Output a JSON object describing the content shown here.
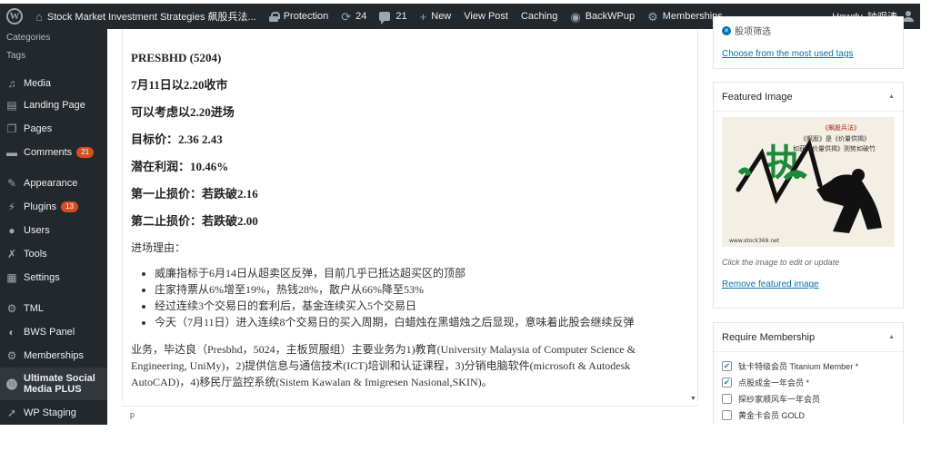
{
  "adminbar": {
    "site_title": "Stock Market Investment Strategies 飙股兵法...",
    "protection": "Protection",
    "updates_count": "24",
    "comments_count": "21",
    "new_label": "New",
    "view_post": "View Post",
    "caching": "Caching",
    "backwpup": "BackWPup",
    "memberships": "Memberships",
    "howdy": "Howdy, 钟观涛"
  },
  "sidebar": {
    "sub_items": [
      "Categories",
      "Tags"
    ],
    "items": [
      {
        "label": "Media",
        "icon": "media-icon"
      },
      {
        "label": "Landing Page",
        "icon": "landing-page-icon"
      },
      {
        "label": "Pages",
        "icon": "pages-icon"
      },
      {
        "label": "Comments",
        "icon": "comments-icon",
        "badge": "21"
      },
      {
        "label": "Appearance",
        "icon": "appearance-icon"
      },
      {
        "label": "Plugins",
        "icon": "plugins-icon",
        "badge": "13"
      },
      {
        "label": "Users",
        "icon": "users-icon"
      },
      {
        "label": "Tools",
        "icon": "tools-icon"
      },
      {
        "label": "Settings",
        "icon": "settings-icon"
      },
      {
        "label": "TML",
        "icon": "tml-icon"
      },
      {
        "label": "BWS Panel",
        "icon": "bws-icon"
      },
      {
        "label": "Memberships",
        "icon": "memberships-icon"
      },
      {
        "label": "Ultimate Social Media PLUS",
        "icon": "usm-icon"
      },
      {
        "label": "WP Staging",
        "icon": "staging-icon"
      }
    ]
  },
  "content": {
    "line1": "PRESBHD (5204)",
    "line2": "7月11日以2.20收市",
    "line3": "可以考虑以2.20进场",
    "line4": "目标价：2.36  2.43",
    "line5": "潜在利润：10.46%",
    "line6": "第一止损价：若跌破2.16",
    "line7": "第二止损价：若跌破2.00",
    "reason_heading": "进场理由：",
    "reasons": [
      "威廉指标于6月14日从超卖区反弹，目前几乎已抵达超买区的顶部",
      "庄家持票从6%增至19%，热钱28%，散户从66%降至53%",
      "经过连续3个交易日的套利后，基金连续买入5个交易日",
      "今天（7月11日）进入连续8个交易日的买入周期，白蜡烛在黑蜡烛之后显现，意味着此股会继续反弹"
    ],
    "business": "业务，毕达良（Presbhd，5024，主板贸服组）主要业务为1)教育(University Malaysia of Computer Science & Engineering, UniMy)，2)提供信息与通信技术(ICT)培训和认证课程，3)分销电脑软件(microsoft & Autodesk AutoCAD)，4)移民厅监控系统(Sistem Kawalan & Imigresen Nasional,SKIN)。"
  },
  "statusbar": {
    "path": "p"
  },
  "tags_panel": {
    "tag": "股项筛选",
    "choose_link": "Choose from the most used tags"
  },
  "featured_panel": {
    "title": "Featured Image",
    "img_line1": "《飙股兵法》",
    "img_line2": "《飙股》是《价量供揭》",
    "img_line3": "如获《价量供揭》则势如破竹",
    "img_url_text": "www.stock369.net",
    "hint": "Click the image to edit or update",
    "remove_link": "Remove featured image"
  },
  "membership_panel": {
    "title": "Require Membership",
    "options": [
      {
        "label": "钛卡特级会员 Titanium Member *",
        "checked": true
      },
      {
        "label": "点股成金一年会员 *",
        "checked": true
      },
      {
        "label": "探纱家顺风车一年会员",
        "checked": false
      },
      {
        "label": "黄金卡会员 GOLD",
        "checked": false
      }
    ]
  }
}
